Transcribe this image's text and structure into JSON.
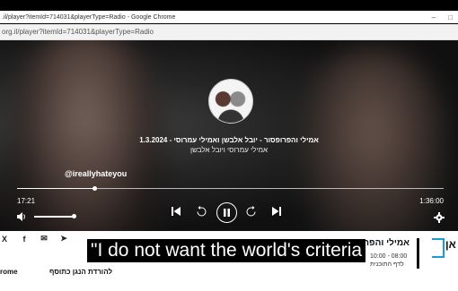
{
  "window": {
    "title": ".il/player?itemId=714031&playerType=Radio - Google Chrome",
    "minimize_label": "–",
    "maximize_label": "□"
  },
  "address_bar": {
    "url": "org.il/player?itemId=714031&playerType=Radio"
  },
  "episode": {
    "title": "1.3.2024 - אמילי והפרופסור - יובל אלבשן ואמילי עמרוסי",
    "hosts": "אמילי עמרוסי ויובל אלבשן"
  },
  "overlay_handle": "@ireallyhateyou",
  "player": {
    "current_time": "17:21",
    "total_time": "1:36:00",
    "progress_fraction": 0.181,
    "volume_fraction": 1.0
  },
  "share": {
    "icons": [
      "x-icon",
      "facebook-icon",
      "email-icon",
      "telegram-icon"
    ],
    "labels": [
      "X",
      "f",
      "✉",
      "➤"
    ]
  },
  "program": {
    "name": "אמילי והפרופסור",
    "time": "10:00 - 08:00",
    "link": "לדף התוכנית"
  },
  "logo": {
    "text": "אן"
  },
  "footer": {
    "left_text": "rome",
    "download_text": "להורדת הנגן כתוסף"
  },
  "subtitle": "\"I do not want the world's criteria",
  "colors": {
    "logo_accent": "#1a9ad6",
    "caption_bg": "#000000"
  }
}
